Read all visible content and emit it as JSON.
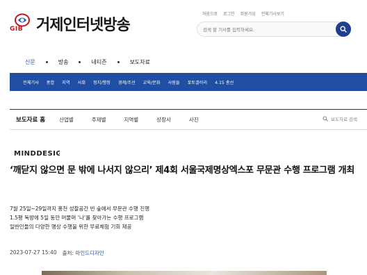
{
  "header": {
    "logo_mark_text": "GIB",
    "site_name": "거제인터넷방송",
    "util_links": [
      "처음으로",
      "로그인",
      "회원가입",
      "전체기사보기"
    ],
    "search_placeholder": "검색 할 기사를 입력하세요."
  },
  "primary_nav": {
    "items": [
      "신문",
      "방송",
      "네티즌",
      "보도자료"
    ],
    "active": "신문"
  },
  "section_nav": {
    "items": [
      "전체기사",
      "종합",
      "지역",
      "사회",
      "정치/행정",
      "경제/조선",
      "교육/문화",
      "사람들",
      "포토갤러리",
      "4.15 총선"
    ]
  },
  "press_bar": {
    "title": "보도자료 홈",
    "tabs": [
      "산업별",
      "주제별",
      "지역별",
      "상장사",
      "사진"
    ],
    "search_label": "보도자료 검색"
  },
  "article": {
    "brand": "MINDDESIGN",
    "headline": "‘깨닫지 않으면 문 밖에 나서지 않으리’ 제4회 서울국제명상엑스포 무문관 수행 프로그램 개최",
    "summary": [
      "7월 25일~29일까지 홍천 성찰공간 빈 숲에서 무문관 수행 진행",
      "1.5평 독방에 5일 동안 머물며 ‘나’를 찾아가는 수행 프로그램",
      "일반인들의 다양한 명상 수행을 위한 무료체험 기회 제공"
    ],
    "datetime": "2023-07-27 15:40",
    "source_label": "출처:",
    "source_name": "마인드디자인"
  },
  "colors": {
    "brand_blue": "#1f4ea3",
    "active_link": "#1a4fbb",
    "logo_red": "#c5141d"
  }
}
